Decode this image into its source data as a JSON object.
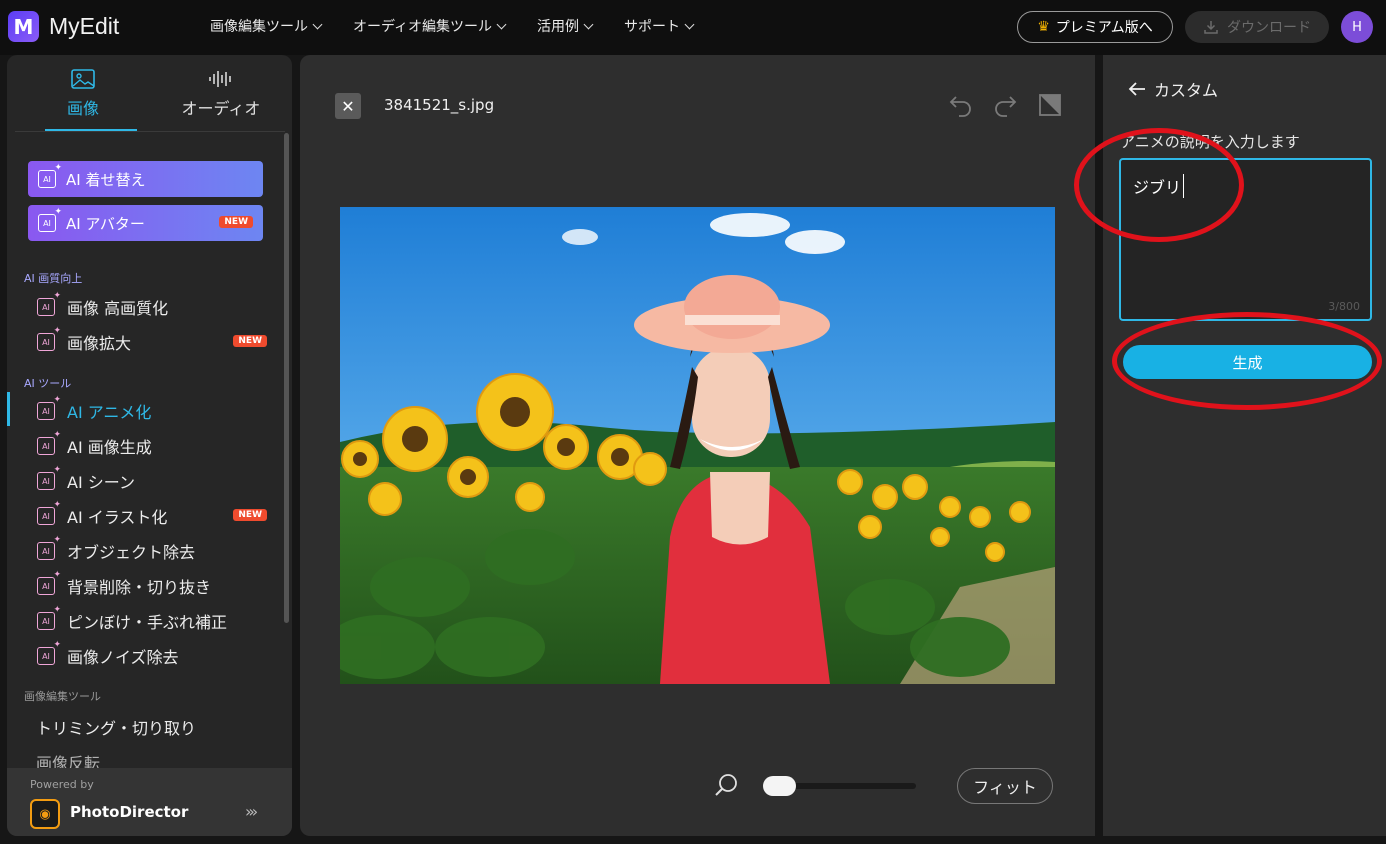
{
  "app": {
    "name": "MyEdit",
    "logo_letter": "M"
  },
  "nav": [
    {
      "label": "画像編集ツール"
    },
    {
      "label": "オーディオ編集ツール"
    },
    {
      "label": "活用例"
    },
    {
      "label": "サポート"
    }
  ],
  "header": {
    "premium_label": "プレミアム版へ",
    "download_label": "ダウンロード",
    "avatar_initial": "H"
  },
  "sidebar": {
    "tabs": [
      {
        "label": "画像"
      },
      {
        "label": "オーディオ"
      }
    ],
    "featured": [
      {
        "label": "AI 着せ替え"
      },
      {
        "label": "AI アバター",
        "badge": "NEW"
      }
    ],
    "sections": [
      {
        "title": "AI 画質向上",
        "items": [
          {
            "label": "画像 高画質化"
          },
          {
            "label": "画像拡大",
            "badge": "NEW"
          }
        ]
      },
      {
        "title": "AI ツール",
        "items": [
          {
            "label": "AI アニメ化"
          },
          {
            "label": "AI 画像生成"
          },
          {
            "label": "AI シーン"
          },
          {
            "label": "AI イラスト化",
            "badge": "NEW"
          },
          {
            "label": "オブジェクト除去"
          },
          {
            "label": "背景削除・切り抜き"
          },
          {
            "label": "ピンぼけ・手ぶれ補正"
          },
          {
            "label": "画像ノイズ除去"
          }
        ]
      },
      {
        "title": "画像編集ツール",
        "items": [
          {
            "label": "トリミング・切り取り"
          },
          {
            "label": "画像反転"
          }
        ]
      }
    ],
    "powered_by": "Powered by",
    "powered_product": "PhotoDirector"
  },
  "editor": {
    "filename": "3841521_s.jpg",
    "fit_label": "フィット",
    "zoom_level": 0.1
  },
  "panel": {
    "back_label": "カスタム",
    "prompt_label": "アニメの説明を入力します",
    "prompt_value": "ジブリ",
    "counter": "3/800",
    "generate_label": "生成"
  },
  "colors": {
    "accent": "#2fb8e6",
    "annotation": "#e0121b",
    "new_badge": "#ef4b2e"
  }
}
